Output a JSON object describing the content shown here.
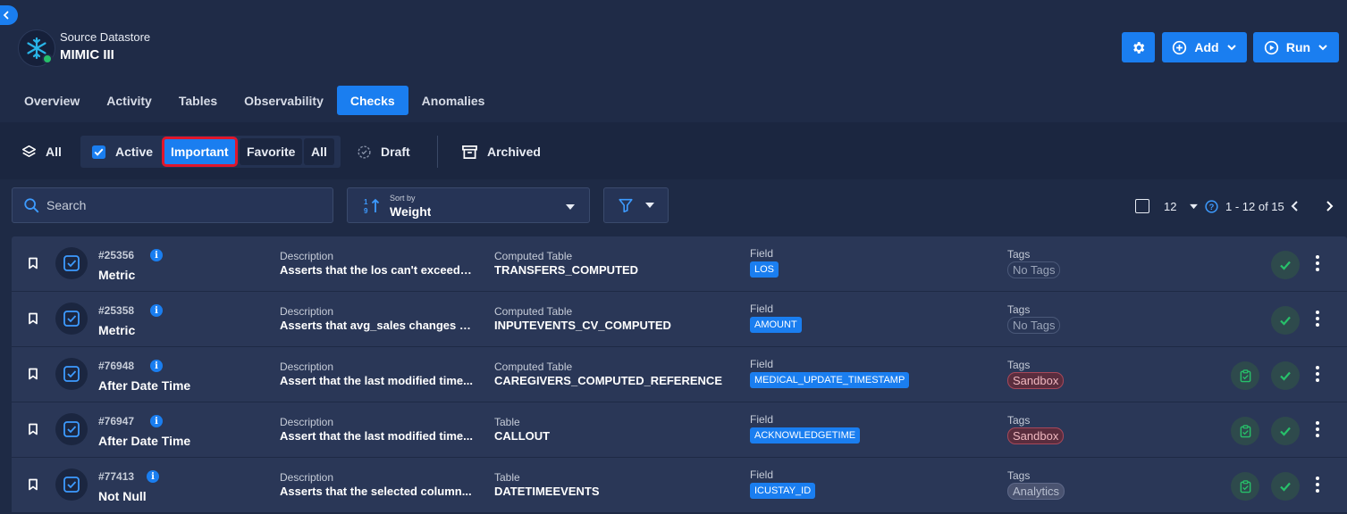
{
  "header": {
    "subtitle": "Source Datastore",
    "title": "MIMIC III",
    "add_label": "Add",
    "run_label": "Run"
  },
  "tabs": [
    {
      "label": "Overview"
    },
    {
      "label": "Activity"
    },
    {
      "label": "Tables"
    },
    {
      "label": "Observability"
    },
    {
      "label": "Checks",
      "active": true
    },
    {
      "label": "Anomalies"
    }
  ],
  "filters": {
    "all": "All",
    "active": "Active",
    "important": "Important",
    "favorite": "Favorite",
    "all_sub": "All",
    "draft": "Draft",
    "archived": "Archived"
  },
  "toolbar": {
    "search_placeholder": "Search",
    "sort_label": "Sort by",
    "sort_value": "Weight",
    "page_size": "12",
    "range": "1 - 12 of 15"
  },
  "rows": [
    {
      "id": "#25356",
      "type": "Metric",
      "desc_label": "Description",
      "desc": "Asserts that the los can't exceed t...",
      "table_label": "Computed Table",
      "table": "TRANSFERS_COMPUTED",
      "field_label": "Field",
      "field": "LOS",
      "tags_label": "Tags",
      "tag": "No Tags",
      "tag_kind": "none",
      "has_clipboard": false
    },
    {
      "id": "#25358",
      "type": "Metric",
      "desc_label": "Description",
      "desc": "Asserts that avg_sales changes b...",
      "table_label": "Computed Table",
      "table": "INPUTEVENTS_CV_COMPUTED",
      "field_label": "Field",
      "field": "AMOUNT",
      "tags_label": "Tags",
      "tag": "No Tags",
      "tag_kind": "none",
      "has_clipboard": false
    },
    {
      "id": "#76948",
      "type": "After Date Time",
      "desc_label": "Description",
      "desc": "Assert that the last modified time...",
      "table_label": "Computed Table",
      "table": "CAREGIVERS_COMPUTED_REFERENCE",
      "field_label": "Field",
      "field": "MEDICAL_UPDATE_TIMESTAMP",
      "tags_label": "Tags",
      "tag": "Sandbox",
      "tag_kind": "sandbox",
      "has_clipboard": true
    },
    {
      "id": "#76947",
      "type": "After Date Time",
      "desc_label": "Description",
      "desc": "Assert that the last modified time...",
      "table_label": "Table",
      "table": "CALLOUT",
      "field_label": "Field",
      "field": "ACKNOWLEDGETIME",
      "tags_label": "Tags",
      "tag": "Sandbox",
      "tag_kind": "sandbox",
      "has_clipboard": true
    },
    {
      "id": "#77413",
      "type": "Not Null",
      "desc_label": "Description",
      "desc": "Asserts that the selected column...",
      "table_label": "Table",
      "table": "DATETIMEEVENTS",
      "field_label": "Field",
      "field": "ICUSTAY_ID",
      "tags_label": "Tags",
      "tag": "Analytics",
      "tag_kind": "analytics",
      "has_clipboard": true
    }
  ],
  "colors": {
    "accent": "#1a7ef0",
    "background": "#1e2a45",
    "row": "#2a3757",
    "success": "#27c06a",
    "highlight_outline": "#e0162b"
  },
  "icons": [
    "chevron-left-icon",
    "snowflake-icon",
    "gear-icon",
    "plus-circle-icon",
    "play-circle-icon",
    "chevron-down-icon",
    "layers-icon",
    "checkbox-icon",
    "draft-icon",
    "archive-icon",
    "search-icon",
    "sort-icon",
    "filter-icon",
    "help-icon",
    "chevron-right-icon",
    "bookmark-icon",
    "check-icon",
    "clipboard-check-icon",
    "kebab-icon",
    "info-icon"
  ]
}
